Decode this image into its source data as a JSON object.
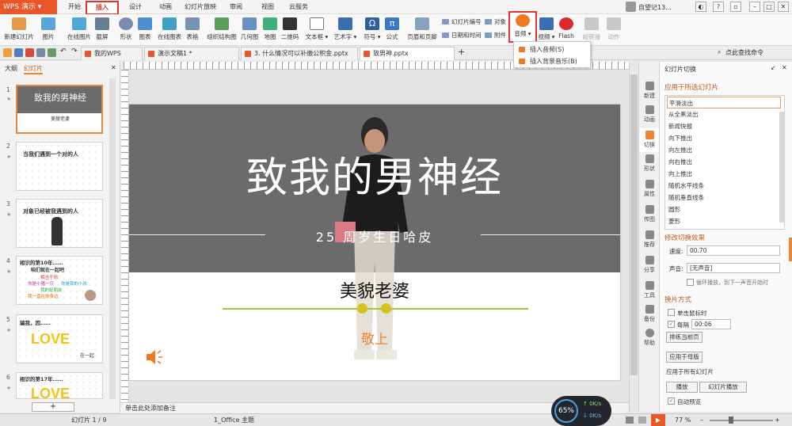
{
  "menubar": {
    "app_button": "WPS 演示",
    "tabs": [
      "开始",
      "插入",
      "设计",
      "动画",
      "幻灯片放映",
      "审阅",
      "视图",
      "云服务"
    ],
    "user": "自望记13..."
  },
  "ribbon": {
    "big": [
      "新建幻灯片",
      "图片",
      "在线图片",
      "截屏",
      "形状",
      "图表",
      "在线图表",
      "表格",
      "组织结构图",
      "几何图",
      "地图",
      "二维码",
      "文本框",
      "艺术字",
      "符号",
      "公式",
      "页眉和页脚"
    ],
    "small": [
      "幻灯片编号",
      "日期和时间",
      "对象",
      "附件"
    ],
    "media": [
      "音频",
      "视频",
      "Flash"
    ],
    "grey": [
      "超链接",
      "动作"
    ]
  },
  "audio_menu": [
    "插入音频(S)",
    "插入背景音乐(B)"
  ],
  "doc_tabs": [
    "我的WPS",
    "演示文稿1 *",
    "3. 什么情况可以补缴公积金.pptx",
    "致男神.pptx"
  ],
  "search_hint": "点此查找命令",
  "left_panel": {
    "tabs": [
      "大纲",
      "幻灯片"
    ],
    "thumbs": [
      {
        "num": "1",
        "title": "致我的男神经",
        "sub": "美貌老婆"
      },
      {
        "num": "2",
        "title": "当我们遇到一个对的人",
        "sub": ""
      },
      {
        "num": "3",
        "title": "对象已经被我遇到的人",
        "sub": ""
      },
      {
        "num": "4",
        "title": "相识的第10年……",
        "lines": [
          "咱们就在一起吧",
          "相当于你",
          "你是小猪一只",
          "你是我的小孩",
          "我的好朋友",
          "我一直在你身边"
        ]
      },
      {
        "num": "5",
        "title": "骗我，因……",
        "big": "LOVE",
        "tail": "在一起"
      },
      {
        "num": "6",
        "title": "相识的第17年……",
        "big": "LOVE"
      }
    ]
  },
  "slide": {
    "title": "致我的男神经",
    "subtitle": "25 周岁生日哈皮",
    "name": "美貌老婆",
    "sign": "敬上"
  },
  "right_panel": {
    "title": "幻灯片切换",
    "apply_heading": "应用于所选幻灯片",
    "transitions": [
      "平滑淡出",
      "从全黑淡出",
      "新闻快报",
      "向下推出",
      "向左推出",
      "向右推出",
      "向上推出",
      "随机水平线条",
      "随机垂直线条",
      "圆形",
      "菱形"
    ],
    "modify_heading": "修改切换效果",
    "speed_label": "速度:",
    "speed_value": "00.70",
    "sound_label": "声音:",
    "sound_value": "[无声音]",
    "loop_label": "循环播放，到下一声音开始时",
    "switch_heading": "换片方式",
    "on_click": "单击鼠标时",
    "every": "每隔",
    "every_value": "00:06",
    "rehearse": "排练当前页",
    "apply_all_btn": "应用于母版",
    "apply_all": "应用于所有幻灯片",
    "play": "播放",
    "slideshow": "幻灯片播放",
    "autopreview": "自动预览"
  },
  "side_icons": [
    "新建",
    "动画",
    "切换",
    "形状",
    "属性",
    "传图",
    "推荐",
    "分享",
    "工具",
    "备份",
    "帮助"
  ],
  "notes_placeholder": "单击此处添加备注",
  "status": {
    "slide_info": "幻灯片 1 / 9",
    "theme": "1_Office 主题",
    "zoom": "77 %"
  },
  "net_widget": {
    "percent": "65%",
    "up": "0K/s",
    "down": "0K/s"
  },
  "colors": {
    "wps_orange": "#e8562a",
    "highlight_red": "#e0342c",
    "slide_dark": "#6b6b6b",
    "sign_orange": "#e8873a",
    "section_orange": "#c25a18"
  }
}
